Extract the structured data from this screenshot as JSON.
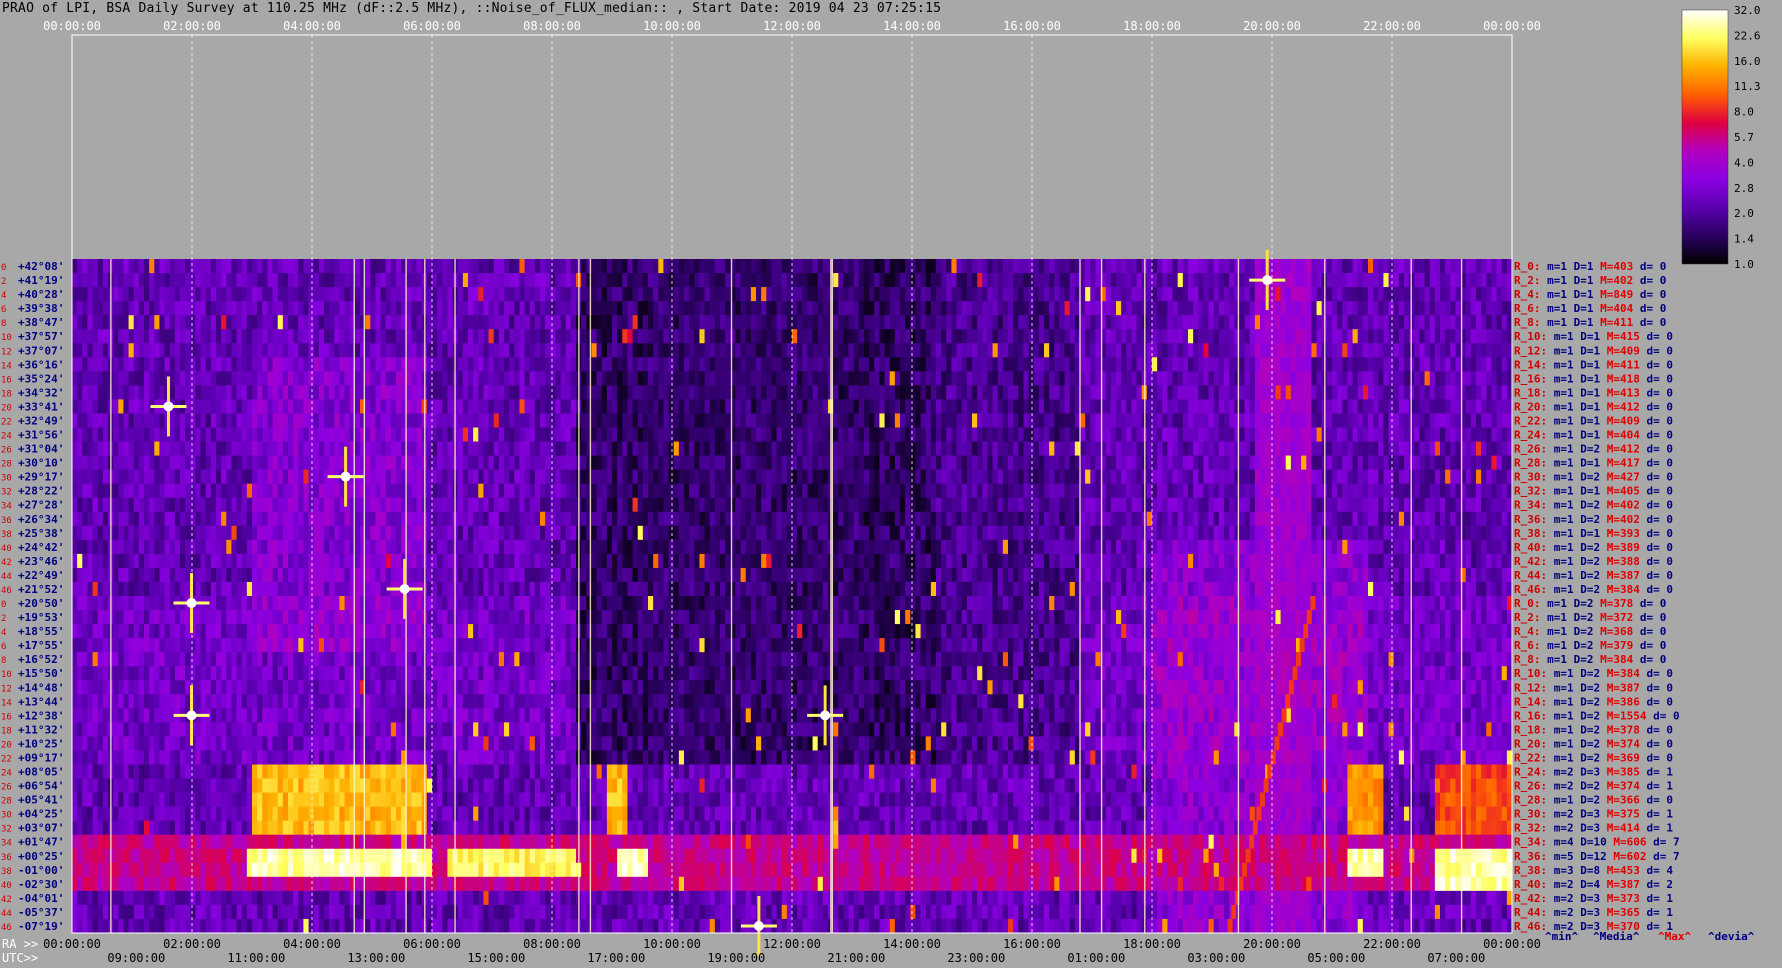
{
  "title": "PRAO of LPI, BSA Daily Survey at 110.25 MHz (dF::2.5 MHz), ::Noise_of_FLUX_median:: , Start Date: 2019 04 23 07:25:15",
  "chart_data": {
    "type": "heatmap",
    "title": "PRAO of LPI, BSA Daily Survey at 110.25 MHz (dF::2.5 MHz), ::Noise_of_FLUX_median:: , Start Date: 2019 04 23 07:25:15",
    "top_axis_ticks": [
      "00:00:00",
      "02:00:00",
      "04:00:00",
      "06:00:00",
      "08:00:00",
      "10:00:00",
      "12:00:00",
      "14:00:00",
      "16:00:00",
      "18:00:00",
      "20:00:00",
      "22:00:00",
      "00:00:00"
    ],
    "ra_axis_label": "RA >>",
    "ra_axis_ticks": [
      "00:00:00",
      "02:00:00",
      "04:00:00",
      "06:00:00",
      "08:00:00",
      "10:00:00",
      "12:00:00",
      "14:00:00",
      "16:00:00",
      "18:00:00",
      "20:00:00",
      "22:00:00",
      "00:00:00"
    ],
    "utc_axis_label": "UTC>>",
    "utc_axis_ticks": [
      "09:00:00",
      "11:00:00",
      "13:00:00",
      "15:00:00",
      "17:00:00",
      "19:00:00",
      "21:00:00",
      "23:00:00",
      "01:00:00",
      "03:00:00",
      "05:00:00",
      "07:00:00"
    ],
    "row_indices": [
      "0",
      "2",
      "4",
      "6",
      "8",
      "10",
      "12",
      "14",
      "16",
      "18",
      "20",
      "22",
      "24",
      "26",
      "28",
      "30",
      "32",
      "34",
      "36",
      "38",
      "40",
      "42",
      "44",
      "46",
      "0",
      "2",
      "4",
      "6",
      "8",
      "10",
      "12",
      "14",
      "16",
      "18",
      "20",
      "22",
      "24",
      "26",
      "28",
      "30",
      "32",
      "34",
      "36",
      "38",
      "40",
      "42",
      "44",
      "46"
    ],
    "declinations": [
      "+42°08'",
      "+41°19'",
      "+40°28'",
      "+39°38'",
      "+38°47'",
      "+37°57'",
      "+37°07'",
      "+36°16'",
      "+35°24'",
      "+34°32'",
      "+33°41'",
      "+32°49'",
      "+31°56'",
      "+31°04'",
      "+30°10'",
      "+29°17'",
      "+28°22'",
      "+27°28'",
      "+26°34'",
      "+25°38'",
      "+24°42'",
      "+23°46'",
      "+22°49'",
      "+21°52'",
      "+20°50'",
      "+19°53'",
      "+18°55'",
      "+17°55'",
      "+16°52'",
      "+15°50'",
      "+14°48'",
      "+13°44'",
      "+12°38'",
      "+11°32'",
      "+10°25'",
      "+09°17'",
      "+08°05'",
      "+06°54'",
      "+05°41'",
      "+04°25'",
      "+03°07'",
      "+01°47'",
      "+00°25'",
      "-01°00'",
      "-02°30'",
      "-04°01'",
      "-05°37'",
      "-07°19'"
    ],
    "beam_stats": [
      {
        "r": "R_0:",
        "m": "m=1",
        "D": "D=1",
        "M": "M=403",
        "d": "d= 0"
      },
      {
        "r": "R_2:",
        "m": "m=1",
        "D": "D=1",
        "M": "M=402",
        "d": "d= 0"
      },
      {
        "r": "R_4:",
        "m": "m=1",
        "D": "D=1",
        "M": "M=849",
        "d": "d= 0"
      },
      {
        "r": "R_6:",
        "m": "m=1",
        "D": "D=1",
        "M": "M=404",
        "d": "d= 0"
      },
      {
        "r": "R_8:",
        "m": "m=1",
        "D": "D=1",
        "M": "M=411",
        "d": "d= 0"
      },
      {
        "r": "R_10:",
        "m": "m=1",
        "D": "D=1",
        "M": "M=415",
        "d": "d= 0"
      },
      {
        "r": "R_12:",
        "m": "m=1",
        "D": "D=1",
        "M": "M=409",
        "d": "d= 0"
      },
      {
        "r": "R_14:",
        "m": "m=1",
        "D": "D=1",
        "M": "M=411",
        "d": "d= 0"
      },
      {
        "r": "R_16:",
        "m": "m=1",
        "D": "D=1",
        "M": "M=418",
        "d": "d= 0"
      },
      {
        "r": "R_18:",
        "m": "m=1",
        "D": "D=1",
        "M": "M=413",
        "d": "d= 0"
      },
      {
        "r": "R_20:",
        "m": "m=1",
        "D": "D=1",
        "M": "M=412",
        "d": "d= 0"
      },
      {
        "r": "R_22:",
        "m": "m=1",
        "D": "D=1",
        "M": "M=409",
        "d": "d= 0"
      },
      {
        "r": "R_24:",
        "m": "m=1",
        "D": "D=1",
        "M": "M=404",
        "d": "d= 0"
      },
      {
        "r": "R_26:",
        "m": "m=1",
        "D": "D=2",
        "M": "M=412",
        "d": "d= 0"
      },
      {
        "r": "R_28:",
        "m": "m=1",
        "D": "D=1",
        "M": "M=417",
        "d": "d= 0"
      },
      {
        "r": "R_30:",
        "m": "m=1",
        "D": "D=2",
        "M": "M=427",
        "d": "d= 0"
      },
      {
        "r": "R_32:",
        "m": "m=1",
        "D": "D=1",
        "M": "M=405",
        "d": "d= 0"
      },
      {
        "r": "R_34:",
        "m": "m=1",
        "D": "D=2",
        "M": "M=402",
        "d": "d= 0"
      },
      {
        "r": "R_36:",
        "m": "m=1",
        "D": "D=2",
        "M": "M=402",
        "d": "d= 0"
      },
      {
        "r": "R_38:",
        "m": "m=1",
        "D": "D=1",
        "M": "M=393",
        "d": "d= 0"
      },
      {
        "r": "R_40:",
        "m": "m=1",
        "D": "D=2",
        "M": "M=389",
        "d": "d= 0"
      },
      {
        "r": "R_42:",
        "m": "m=1",
        "D": "D=2",
        "M": "M=388",
        "d": "d= 0"
      },
      {
        "r": "R_44:",
        "m": "m=1",
        "D": "D=2",
        "M": "M=387",
        "d": "d= 0"
      },
      {
        "r": "R_46:",
        "m": "m=1",
        "D": "D=2",
        "M": "M=384",
        "d": "d= 0"
      },
      {
        "r": "R_0:",
        "m": "m=1",
        "D": "D=2",
        "M": "M=378",
        "d": "d= 0"
      },
      {
        "r": "R_2:",
        "m": "m=1",
        "D": "D=2",
        "M": "M=372",
        "d": "d= 0"
      },
      {
        "r": "R_4:",
        "m": "m=1",
        "D": "D=2",
        "M": "M=368",
        "d": "d= 0"
      },
      {
        "r": "R_6:",
        "m": "m=1",
        "D": "D=2",
        "M": "M=379",
        "d": "d= 0"
      },
      {
        "r": "R_8:",
        "m": "m=1",
        "D": "D=2",
        "M": "M=384",
        "d": "d= 0"
      },
      {
        "r": "R_10:",
        "m": "m=1",
        "D": "D=2",
        "M": "M=384",
        "d": "d= 0"
      },
      {
        "r": "R_12:",
        "m": "m=1",
        "D": "D=2",
        "M": "M=387",
        "d": "d= 0"
      },
      {
        "r": "R_14:",
        "m": "m=1",
        "D": "D=2",
        "M": "M=386",
        "d": "d= 0"
      },
      {
        "r": "R_16:",
        "m": "m=1",
        "D": "D=2",
        "M": "M=1554",
        "d": "d= 0"
      },
      {
        "r": "R_18:",
        "m": "m=1",
        "D": "D=2",
        "M": "M=378",
        "d": "d= 0"
      },
      {
        "r": "R_20:",
        "m": "m=1",
        "D": "D=2",
        "M": "M=374",
        "d": "d= 0"
      },
      {
        "r": "R_22:",
        "m": "m=1",
        "D": "D=2",
        "M": "M=369",
        "d": "d= 0"
      },
      {
        "r": "R_24:",
        "m": "m=2",
        "D": "D=3",
        "M": "M=385",
        "d": "d= 1"
      },
      {
        "r": "R_26:",
        "m": "m=2",
        "D": "D=2",
        "M": "M=374",
        "d": "d= 1"
      },
      {
        "r": "R_28:",
        "m": "m=1",
        "D": "D=2",
        "M": "M=366",
        "d": "d= 0"
      },
      {
        "r": "R_30:",
        "m": "m=2",
        "D": "D=3",
        "M": "M=375",
        "d": "d= 1"
      },
      {
        "r": "R_32:",
        "m": "m=2",
        "D": "D=3",
        "M": "M=414",
        "d": "d= 1"
      },
      {
        "r": "R_34:",
        "m": "m=4",
        "D": "D=10",
        "M": "M=606",
        "d": "d= 7"
      },
      {
        "r": "R_36:",
        "m": "m=5",
        "D": "D=12",
        "M": "M=602",
        "d": "d= 7"
      },
      {
        "r": "R_38:",
        "m": "m=3",
        "D": "D=8",
        "M": "M=453",
        "d": "d= 4"
      },
      {
        "r": "R_40:",
        "m": "m=2",
        "D": "D=4",
        "M": "M=387",
        "d": "d= 2"
      },
      {
        "r": "R_42:",
        "m": "m=2",
        "D": "D=3",
        "M": "M=373",
        "d": "d= 1"
      },
      {
        "r": "R_44:",
        "m": "m=2",
        "D": "D=3",
        "M": "M=365",
        "d": "d= 1"
      },
      {
        "r": "R_46:",
        "m": "m=2",
        "D": "D=3",
        "M": "M=370",
        "d": "d= 1"
      }
    ],
    "stats_legend": [
      "^min^",
      "^Media^",
      "^Max^",
      "^devia^"
    ],
    "colorbar_ticks": [
      "32.0",
      "22.6",
      "16.0",
      "11.3",
      "8.0",
      "5.7",
      "4.0",
      "2.8",
      "2.0",
      "1.4",
      "1.0"
    ],
    "colorbar_scale": "log",
    "colors": {
      "background": "#a8a8a8",
      "colormap": [
        "#000000",
        "#2a0060",
        "#5a00b0",
        "#8a00e0",
        "#b000c0",
        "#e00040",
        "#ff6000",
        "#ffb000",
        "#ffff60",
        "#ffffff"
      ],
      "row_index_color": "#d00000",
      "declination_color": "#000080",
      "beam_label_color": "#d00000",
      "stat_color": "#000080",
      "max_color": "#e00000"
    },
    "heatmap_regions": [
      {
        "type": "band_rows",
        "rows": [
          41,
          44
        ],
        "t": [
          0.0,
          1.0
        ],
        "level": 0.55
      },
      {
        "type": "band_rows",
        "rows": [
          42,
          43
        ],
        "t": [
          0.12,
          0.25
        ],
        "level": 1.0
      },
      {
        "type": "band_rows",
        "rows": [
          42,
          43
        ],
        "t": [
          0.26,
          0.35
        ],
        "level": 0.95
      },
      {
        "type": "band_rows",
        "rows": [
          42,
          43
        ],
        "t": [
          0.38,
          0.4
        ],
        "level": 1.0
      },
      {
        "type": "band_rows",
        "rows": [
          42,
          43
        ],
        "t": [
          0.885,
          0.91
        ],
        "level": 1.0
      },
      {
        "type": "band_rows",
        "rows": [
          42,
          44
        ],
        "t": [
          0.945,
          1.0
        ],
        "level": 1.0
      },
      {
        "type": "band_rows",
        "rows": [
          36,
          40
        ],
        "t": [
          0.125,
          0.245
        ],
        "level": 0.85
      },
      {
        "type": "band_rows",
        "rows": [
          36,
          40
        ],
        "t": [
          0.37,
          0.385
        ],
        "level": 0.85
      },
      {
        "type": "band_rows",
        "rows": [
          36,
          40
        ],
        "t": [
          0.885,
          0.91
        ],
        "level": 0.8
      },
      {
        "type": "band_rows",
        "rows": [
          36,
          40
        ],
        "t": [
          0.945,
          1.0
        ],
        "level": 0.7
      },
      {
        "type": "band_rows",
        "rows": [
          0,
          47
        ],
        "t": [
          0.82,
          0.86
        ],
        "level": 0.45
      },
      {
        "type": "band_rows",
        "rows": [
          0,
          35
        ],
        "t": [
          0.4,
          0.55
        ],
        "level": 0.15
      }
    ],
    "vertical_lines_t": [
      0.027,
      0.196,
      0.203,
      0.232,
      0.245,
      0.266,
      0.352,
      0.36,
      0.458,
      0.527,
      0.528,
      0.7,
      0.715,
      0.745,
      0.81,
      0.87,
      0.93,
      0.965
    ],
    "bright_sources": [
      {
        "t": 0.083,
        "row": 32,
        "level": 1.0
      },
      {
        "t": 0.083,
        "row": 24,
        "level": 0.9
      },
      {
        "t": 0.231,
        "row": 23,
        "level": 1.0
      },
      {
        "t": 0.19,
        "row": 15,
        "level": 0.95
      },
      {
        "t": 0.523,
        "row": 32,
        "level": 1.0
      },
      {
        "t": 0.83,
        "row": 1,
        "level": 1.0
      },
      {
        "t": 0.477,
        "row": 47,
        "level": 1.0
      },
      {
        "t": 0.067,
        "row": 10,
        "level": 0.95
      }
    ]
  }
}
